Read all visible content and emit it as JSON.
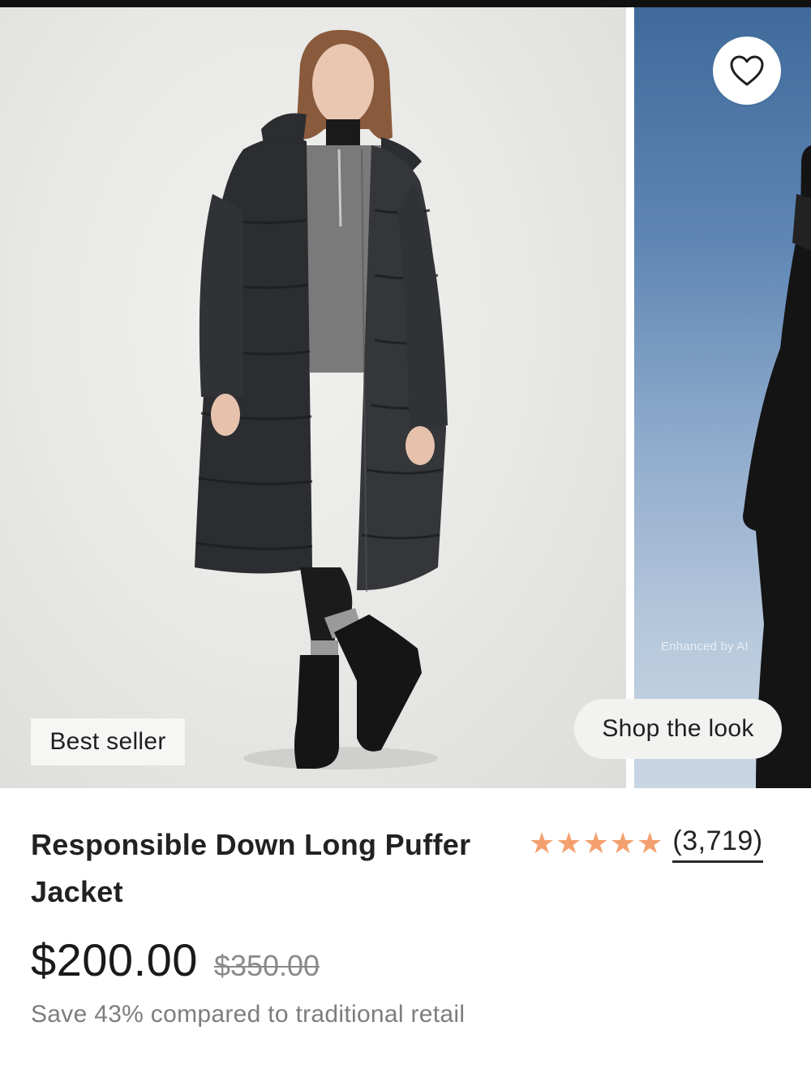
{
  "gallery": {
    "badge_label": "Best seller",
    "shop_look_label": "Shop the look",
    "enhanced_label": "Enhanced by AI",
    "wishlist_icon": "heart-icon"
  },
  "product": {
    "title": "Responsible Down Long Puffer Jacket",
    "rating": 5,
    "rating_max": 5,
    "review_count": "(3,719)",
    "price": "$200.00",
    "original_price": "$350.00",
    "savings_text": "Save 43% compared to traditional retail"
  },
  "colors": {
    "star": "#f4a06e",
    "coat": "#2b2d30",
    "background": "#ffffff"
  }
}
